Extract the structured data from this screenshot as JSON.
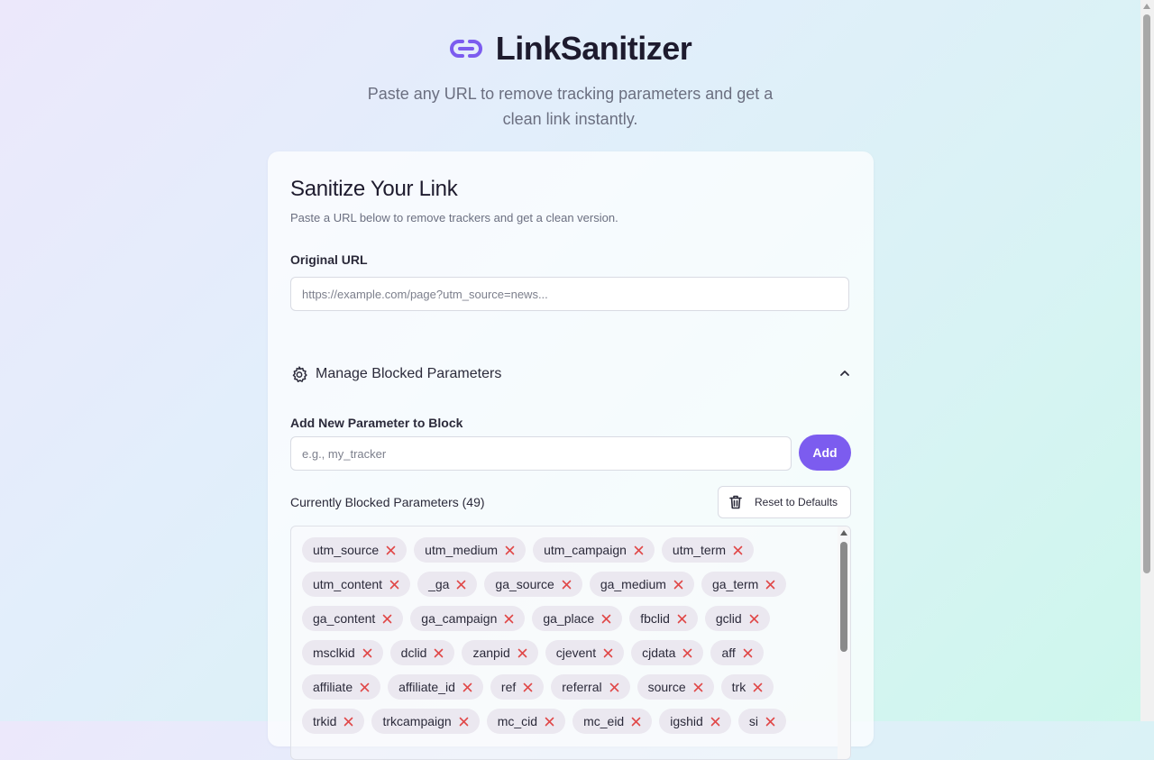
{
  "app": {
    "title": "LinkSanitizer",
    "tagline": "Paste any URL to remove tracking parameters and get a clean link instantly.",
    "accent_color": "#7c5cef",
    "icon": "link-icon"
  },
  "card": {
    "title": "Sanitize Your Link",
    "description": "Paste a URL below to remove trackers and get a clean version.",
    "url_label": "Original URL",
    "url_value": "",
    "url_placeholder": "https://example.com/page?utm_source=news..."
  },
  "manage": {
    "title": "Manage Blocked Parameters",
    "icon": "gear-icon",
    "expanded": true,
    "add_label": "Add New Parameter to Block",
    "add_value": "",
    "add_placeholder": "e.g., my_tracker",
    "add_button": "Add",
    "blocked_label": "Currently Blocked Parameters (49)",
    "reset_button": "Reset to Defaults",
    "remove_color": "#e04848",
    "params": [
      "utm_source",
      "utm_medium",
      "utm_campaign",
      "utm_term",
      "utm_content",
      "_ga",
      "ga_source",
      "ga_medium",
      "ga_term",
      "ga_content",
      "ga_campaign",
      "ga_place",
      "fbclid",
      "gclid",
      "msclkid",
      "dclid",
      "zanpid",
      "cjevent",
      "cjdata",
      "aff",
      "affiliate",
      "affiliate_id",
      "ref",
      "referral",
      "source",
      "trk",
      "trkid",
      "trkcampaign",
      "mc_cid",
      "mc_eid",
      "igshid",
      "si"
    ]
  }
}
